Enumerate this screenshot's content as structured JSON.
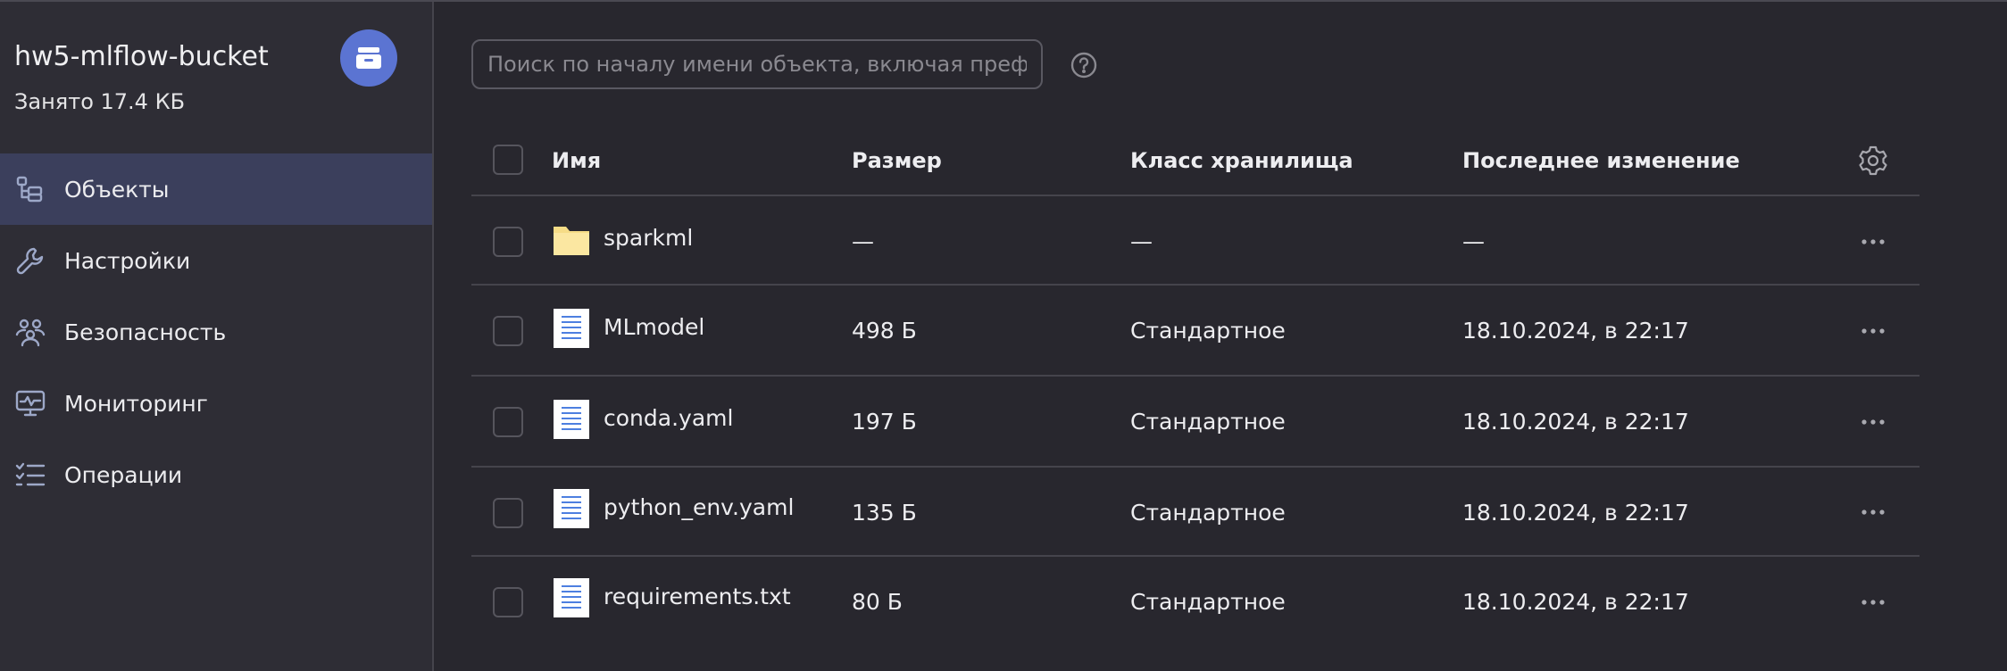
{
  "bucket": {
    "name": "hw5-mlflow-bucket",
    "used": "Занято 17.4 КБ",
    "avatar_icon": "archive-box-icon",
    "avatar_color": "#5b74d2"
  },
  "sidebar": {
    "items": [
      {
        "label": "Объекты",
        "icon": "objects-tree-icon",
        "active": true
      },
      {
        "label": "Настройки",
        "icon": "wrench-icon",
        "active": false
      },
      {
        "label": "Безопасность",
        "icon": "users-group-icon",
        "active": false
      },
      {
        "label": "Мониторинг",
        "icon": "monitor-pulse-icon",
        "active": false
      },
      {
        "label": "Операции",
        "icon": "checklist-icon",
        "active": false
      }
    ]
  },
  "search": {
    "placeholder": "Поиск по началу имени объекта, включая префикс",
    "value": "",
    "help_icon": "question-circle-icon"
  },
  "table": {
    "headers": {
      "name": "Имя",
      "size": "Размер",
      "storage_class": "Класс хранилища",
      "modified": "Последнее изменение"
    },
    "settings_icon": "gear-icon",
    "rows": [
      {
        "type": "folder",
        "icon": "folder-icon",
        "name": "sparkml",
        "size": "—",
        "storage_class": "—",
        "modified": "—"
      },
      {
        "type": "file",
        "icon": "file-document-icon",
        "name": "MLmodel",
        "size": "498 Б",
        "storage_class": "Стандартное",
        "modified": "18.10.2024, в 22:17"
      },
      {
        "type": "file",
        "icon": "file-document-icon",
        "name": "conda.yaml",
        "size": "197 Б",
        "storage_class": "Стандартное",
        "modified": "18.10.2024, в 22:17"
      },
      {
        "type": "file",
        "icon": "file-document-icon",
        "name": "python_env.yaml",
        "size": "135 Б",
        "storage_class": "Стандартное",
        "modified": "18.10.2024, в 22:17"
      },
      {
        "type": "file",
        "icon": "file-document-icon",
        "name": "requirements.txt",
        "size": "80 Б",
        "storage_class": "Стандартное",
        "modified": "18.10.2024, в 22:17"
      }
    ]
  },
  "colors": {
    "background": "#28272e",
    "sidebar": "#2e2d35",
    "active_item": "#3b3f5c",
    "accent": "#5b74d2",
    "folder": "#f6dc86",
    "file_lines": "#4d7fe0"
  }
}
